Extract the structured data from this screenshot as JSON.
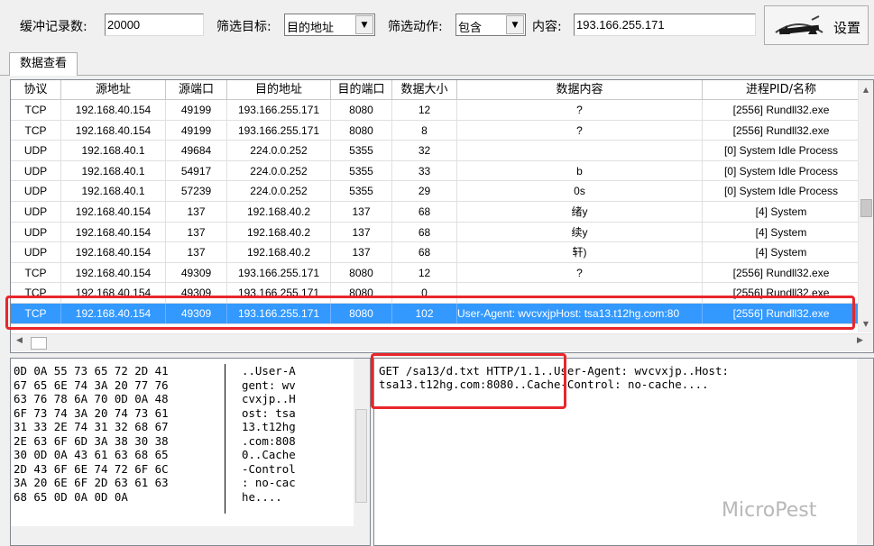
{
  "toolbar": {
    "buffer_label": "缓冲记录数:",
    "buffer_value": "20000",
    "target_label": "筛选目标:",
    "target_value": "目的地址",
    "action_label": "筛选动作:",
    "action_value": "包含",
    "content_label": "内容:",
    "content_value": "193.166.255.171",
    "settings_label": "设置"
  },
  "tab": {
    "label": "数据查看"
  },
  "grid": {
    "columns": [
      "协议",
      "源地址",
      "源端口",
      "目的地址",
      "目的端口",
      "数据大小",
      "数据内容",
      "进程PID/名称"
    ],
    "rows": [
      [
        "TCP",
        "192.168.40.154",
        "49199",
        "193.166.255.171",
        "8080",
        "12",
        "?",
        "[2556] Rundll32.exe"
      ],
      [
        "TCP",
        "192.168.40.154",
        "49199",
        "193.166.255.171",
        "8080",
        "8",
        "?",
        "[2556] Rundll32.exe"
      ],
      [
        "UDP",
        "192.168.40.1",
        "49684",
        "224.0.0.252",
        "5355",
        "32",
        "",
        "[0] System Idle Process"
      ],
      [
        "UDP",
        "192.168.40.1",
        "54917",
        "224.0.0.252",
        "5355",
        "33",
        "b",
        "[0] System Idle Process"
      ],
      [
        "UDP",
        "192.168.40.1",
        "57239",
        "224.0.0.252",
        "5355",
        "29",
        "0s",
        "[0] System Idle Process"
      ],
      [
        "UDP",
        "192.168.40.154",
        "137",
        "192.168.40.2",
        "137",
        "68",
        "绪y",
        "[4] System"
      ],
      [
        "UDP",
        "192.168.40.154",
        "137",
        "192.168.40.2",
        "137",
        "68",
        "续y",
        "[4] System"
      ],
      [
        "UDP",
        "192.168.40.154",
        "137",
        "192.168.40.2",
        "137",
        "68",
        "轩)",
        "[4] System"
      ],
      [
        "TCP",
        "192.168.40.154",
        "49309",
        "193.166.255.171",
        "8080",
        "12",
        "?",
        "[2556] Rundll32.exe"
      ],
      [
        "TCP",
        "192.168.40.154",
        "49309",
        "193.166.255.171",
        "8080",
        "0",
        "",
        "[2556] Rundll32.exe"
      ],
      [
        "TCP",
        "192.168.40.154",
        "49309",
        "193.166.255.171",
        "8080",
        "102",
        "User-Agent: wvcvxjpHost: tsa13.t12hg.com:80",
        "[2556] Rundll32.exe"
      ]
    ],
    "selected_row": 10
  },
  "hex": {
    "bytes": "0D 0A 55 73 65 72 2D 41\n67 65 6E 74 3A 20 77 76\n63 76 78 6A 70 0D 0A 48\n6F 73 74 3A 20 74 73 61\n31 33 2E 74 31 32 68 67\n2E 63 6F 6D 3A 38 30 38\n30 0D 0A 43 61 63 68 65\n2D 43 6F 6E 74 72 6F 6C\n3A 20 6E 6F 2D 63 61 63\n68 65 0D 0A 0D 0A",
    "ascii": "..User-A\ngent: wv\ncvxjp..H\nost: tsa\n13.t12hg\n.com:808\n0..Cache\n-Control\n: no-cac\nhe...."
  },
  "text": {
    "content": "GET /sa13/d.txt HTTP/1.1..User-Agent: wvcvxjp..Host: tsa13.t12hg.com:8080..Cache-Control: no-cache...."
  },
  "watermark": "MicroPest"
}
